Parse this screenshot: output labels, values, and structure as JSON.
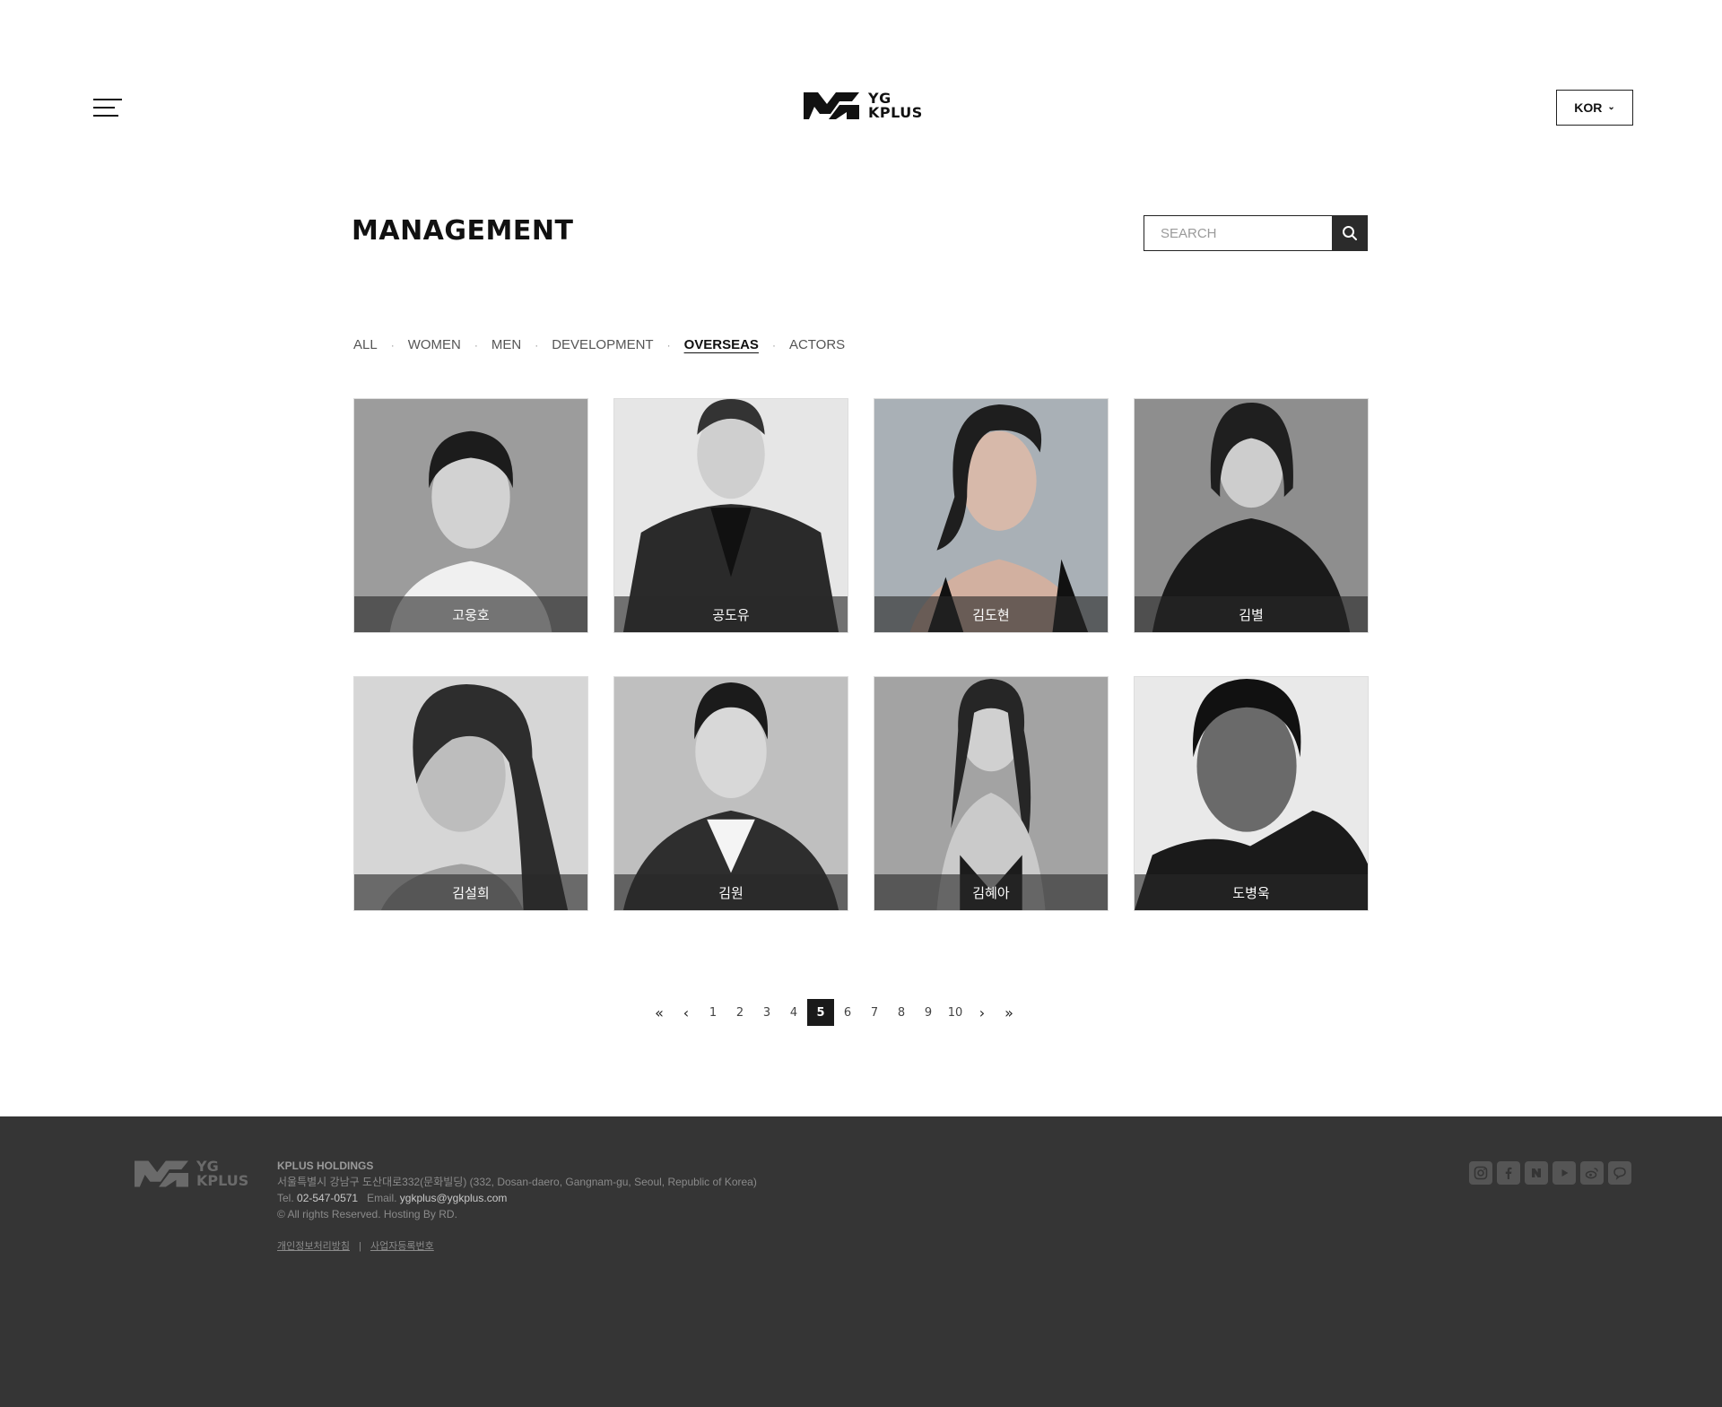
{
  "header": {
    "logo_text_line1": "YG",
    "logo_text_line2": "KPLUS",
    "language": "KOR"
  },
  "page": {
    "title": "MANAGEMENT",
    "search_placeholder": "SEARCH"
  },
  "tabs": [
    {
      "label": "ALL",
      "active": false
    },
    {
      "label": "WOMEN",
      "active": false
    },
    {
      "label": "MEN",
      "active": false
    },
    {
      "label": "DEVELOPMENT",
      "active": false
    },
    {
      "label": "OVERSEAS",
      "active": true
    },
    {
      "label": "ACTORS",
      "active": false
    }
  ],
  "models": [
    {
      "name": "고웅호"
    },
    {
      "name": "공도유"
    },
    {
      "name": "김도현"
    },
    {
      "name": "김별"
    },
    {
      "name": "김설희"
    },
    {
      "name": "김원"
    },
    {
      "name": "김혜아"
    },
    {
      "name": "도병욱"
    }
  ],
  "pagination": {
    "first": "«",
    "prev": "‹",
    "pages": [
      "1",
      "2",
      "3",
      "4",
      "5",
      "6",
      "7",
      "8",
      "9",
      "10"
    ],
    "current": "5",
    "next": "›",
    "last": "»"
  },
  "footer": {
    "logo_text_line1": "YG",
    "logo_text_line2": "KPLUS",
    "company": "KPLUS HOLDINGS",
    "address": "서울특별시 강남구 도산대로332(문화빌딩) (332, Dosan-daero, Gangnam-gu, Seoul, Republic of Korea)",
    "tel_label": "Tel.",
    "tel": "02-547-0571",
    "email_label": "Email.",
    "email": "ygkplus@ygkplus.com",
    "copyright": "© All rights Reserved. Hosting By RD.",
    "privacy_link": "개인정보처리방침",
    "business_link": "사업자등록번호",
    "link_separator": "|"
  },
  "social_icons": [
    "instagram-icon",
    "facebook-icon",
    "naver-icon",
    "youtube-icon",
    "weibo-icon",
    "line-icon"
  ],
  "colors": {
    "footer_bg": "#353535",
    "active_page_bg": "#1a1a1a",
    "search_button_bg": "#2b2b2b"
  }
}
